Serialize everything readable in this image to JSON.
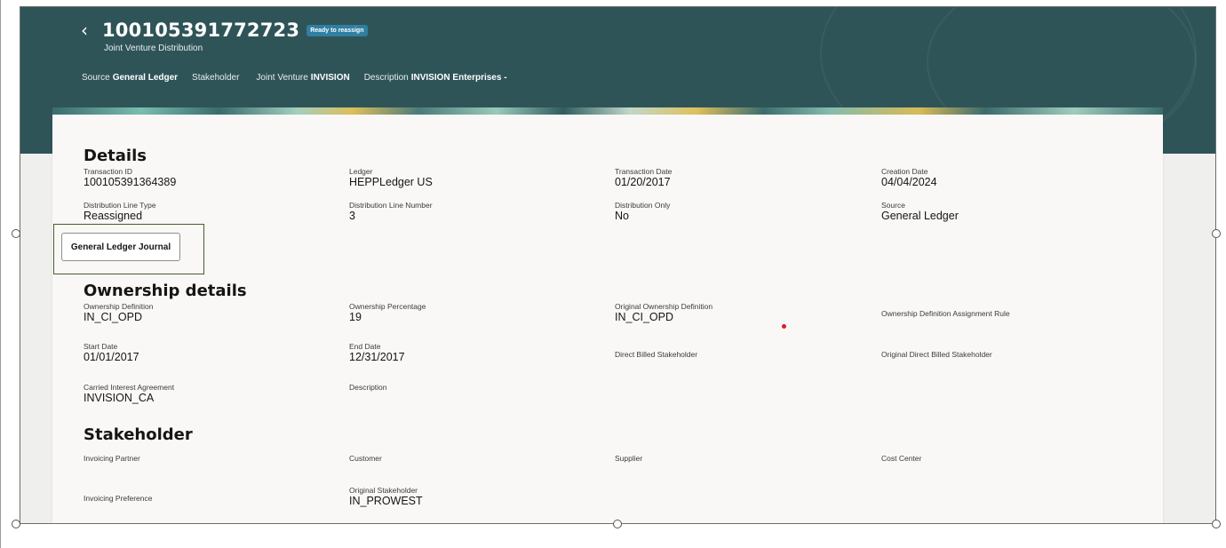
{
  "header": {
    "back_icon": "chevron-left-icon",
    "title": "100105391772723",
    "badge": "Ready to reassign",
    "subtitle": "Joint Venture Distribution",
    "meta": [
      {
        "label": "Source",
        "value": "General Ledger"
      },
      {
        "label": "Stakeholder",
        "value": ""
      },
      {
        "label": "Joint Venture",
        "value": "INVISION"
      },
      {
        "label": "Description",
        "value": "INVISION Enterprises -"
      }
    ]
  },
  "details": {
    "title": "Details",
    "row1": [
      {
        "label": "Transaction ID",
        "value": "100105391364389"
      },
      {
        "label": "Ledger",
        "value": "HEPPLedger US"
      },
      {
        "label": "Transaction Date",
        "value": "01/20/2017"
      },
      {
        "label": "Creation Date",
        "value": "04/04/2024"
      }
    ],
    "row2": [
      {
        "label": "Distribution Line Type",
        "value": "Reassigned"
      },
      {
        "label": "Distribution Line Number",
        "value": "3"
      },
      {
        "label": "Distribution Only",
        "value": "No"
      },
      {
        "label": "Source",
        "value": "General Ledger"
      }
    ],
    "gl_button": "General Ledger Journal"
  },
  "ownership": {
    "title": "Ownership details",
    "row1": [
      {
        "label": "Ownership Definition",
        "value": "IN_CI_OPD"
      },
      {
        "label": "Ownership Percentage",
        "value": "19"
      },
      {
        "label": "Original Ownership Definition",
        "value": "IN_CI_OPD"
      },
      {
        "label": "Ownership Definition Assignment Rule",
        "value": ""
      }
    ],
    "row2": [
      {
        "label": "Start Date",
        "value": "01/01/2017"
      },
      {
        "label": "End Date",
        "value": "12/31/2017"
      },
      {
        "label": "Direct Billed Stakeholder",
        "value": ""
      },
      {
        "label": "Original Direct Billed Stakeholder",
        "value": ""
      }
    ],
    "row3": [
      {
        "label": "Carried Interest Agreement",
        "value": "INVISION_CA"
      },
      {
        "label": "Description",
        "value": ""
      }
    ]
  },
  "stakeholder": {
    "title": "Stakeholder",
    "row1": [
      {
        "label": "Invoicing Partner",
        "value": ""
      },
      {
        "label": "Customer",
        "value": ""
      },
      {
        "label": "Supplier",
        "value": ""
      },
      {
        "label": "Cost Center",
        "value": ""
      }
    ],
    "row2": [
      {
        "label": "Invoicing Preference",
        "value": ""
      },
      {
        "label": "Original Stakeholder",
        "value": "IN_PROWEST"
      }
    ]
  },
  "colors": {
    "header_bg": "#2f5458",
    "badge_bg": "#2f7fa3",
    "focus_outline": "#4a5b2a"
  }
}
